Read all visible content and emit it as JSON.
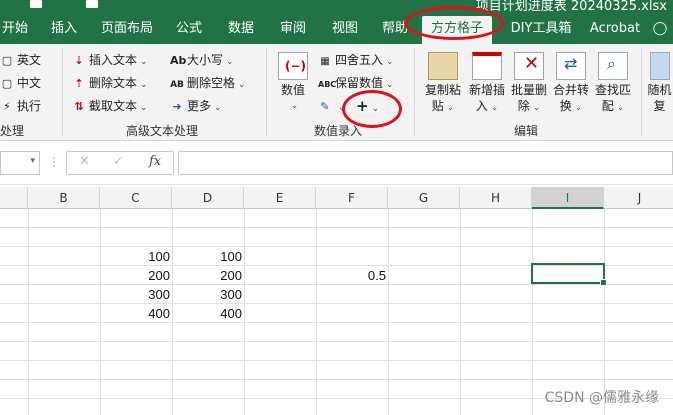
{
  "window": {
    "file_title": "项目计划进度表 20240325.xlsx"
  },
  "tabs": [
    {
      "label": "开始"
    },
    {
      "label": "插入"
    },
    {
      "label": "页面布局"
    },
    {
      "label": "公式"
    },
    {
      "label": "数据"
    },
    {
      "label": "审阅"
    },
    {
      "label": "视图"
    },
    {
      "label": "帮助"
    },
    {
      "label": "方方格子"
    },
    {
      "label": "DIY工具箱"
    },
    {
      "label": "Acrobat"
    }
  ],
  "ribbon": {
    "left_group": {
      "items": [
        "英文",
        "中文",
        "执行"
      ],
      "label": "处理"
    },
    "advanced_text": {
      "items": [
        "插入文本",
        "删除文本",
        "截取文本",
        "大小写",
        "删除空格",
        "更多"
      ],
      "label": "高级文本处理"
    },
    "numeric": {
      "big_button": "数值",
      "items": [
        "四舍五入",
        "保留数值"
      ],
      "plus_symbol": "+",
      "label": "数值录入"
    },
    "edit": {
      "buttons": [
        {
          "label1": "复制粘",
          "label2": "贴"
        },
        {
          "label1": "新增插",
          "label2": "入"
        },
        {
          "label1": "批量删",
          "label2": "除"
        },
        {
          "label1": "合并转",
          "label2": "换"
        },
        {
          "label1": "查找匹",
          "label2": "配"
        },
        {
          "label1": "随机",
          "label2": "复"
        }
      ],
      "label": "编辑"
    }
  },
  "formula_bar": {
    "cancel_symbol": "✕",
    "enter_symbol": "✓",
    "fx_symbol": "fx",
    "value": ""
  },
  "sheet": {
    "columns": [
      "B",
      "C",
      "D",
      "E",
      "F",
      "G",
      "H",
      "I",
      "J"
    ],
    "selected_column": "I",
    "cells": [
      {
        "col": "C",
        "row": 1,
        "value": "100"
      },
      {
        "col": "D",
        "row": 1,
        "value": "100"
      },
      {
        "col": "C",
        "row": 2,
        "value": "200"
      },
      {
        "col": "D",
        "row": 2,
        "value": "200"
      },
      {
        "col": "F",
        "row": 2,
        "value": "0.5"
      },
      {
        "col": "C",
        "row": 3,
        "value": "300"
      },
      {
        "col": "D",
        "row": 3,
        "value": "300"
      },
      {
        "col": "C",
        "row": 4,
        "value": "400"
      },
      {
        "col": "D",
        "row": 4,
        "value": "400"
      }
    ]
  },
  "watermark": "CSDN @儒雅永缘",
  "annotation_color": "#e0101a",
  "accent_color": "#217346"
}
